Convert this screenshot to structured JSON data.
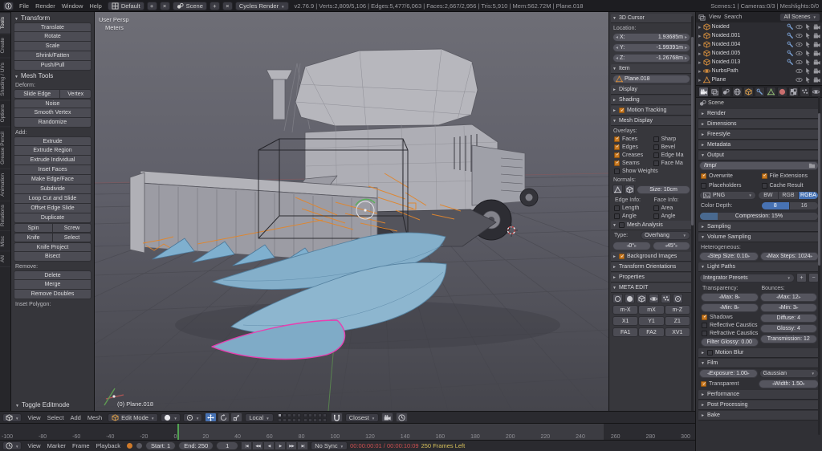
{
  "colors": {
    "accent_blue": "#4772b3",
    "check_orange": "#c97a23",
    "selected_magenta": "#e83eb0",
    "wire_orange": "#e0862e",
    "model_blue": "#84afca",
    "timecode_red": "#cf5050",
    "frames_left_yellow": "#d8c15a"
  },
  "icons": {
    "plus": "+",
    "close": "×",
    "minus": "−"
  },
  "info_bar": {
    "menus": [
      "File",
      "Render",
      "Window",
      "Help"
    ],
    "layout_name": "Default",
    "scene_name": "Scene",
    "engine": "Cycles Render",
    "stats": "v2.76.9 | Verts:2,809/5,106 | Edges:5,477/6,063 | Faces:2,667/2,956 | Tris:5,910 | Mem:562.72M | Plane.018",
    "scene_stats": "Scenes:1 | Cameras:0/3 | Meshlights:0/0"
  },
  "tab_strip": [
    "Tools",
    "Create",
    "Shading / UVs",
    "Options",
    "Grease Pencil",
    "Animation",
    "Relations",
    "Misc",
    "AN"
  ],
  "tool_shelf": {
    "transform_title": "Transform",
    "transform_buttons": [
      "Translate",
      "Rotate",
      "Scale",
      "Shrink/Fatten",
      "Push/Pull"
    ],
    "mesh_tools_title": "Mesh Tools",
    "deform_label": "Deform:",
    "slide_edge": "Slide Edge",
    "slide_vertex": "Vertex",
    "deform_buttons": [
      "Noise",
      "Smooth Vertex",
      "Randomize"
    ],
    "add_label": "Add:",
    "add_buttons": [
      "Extrude",
      "Extrude Region",
      "Extrude Individual",
      "Inset Faces",
      "Make Edge/Face",
      "Subdivide",
      "Loop Cut and Slide",
      "Offset Edge Slide",
      "Duplicate"
    ],
    "spin": "Spin",
    "screw": "Screw",
    "knife": "Knife",
    "knife_select": "Select",
    "add_buttons_2": [
      "Knife Project",
      "Bisect"
    ],
    "remove_label": "Remove:",
    "remove_buttons": [
      "Delete",
      "Merge",
      "Remove Doubles"
    ],
    "inset_label": "Inset Polygon:",
    "toggle_editmode": "Toggle Editmode"
  },
  "viewport": {
    "view_label": "User Persp",
    "unit_label": "Meters",
    "active_object": "(0) Plane.018"
  },
  "n_panel": {
    "cursor_title": "3D Cursor",
    "location_label": "Location:",
    "cursor_fields": [
      {
        "l": "X:",
        "v": "1.93685m"
      },
      {
        "l": "Y:",
        "v": "-1.99391m"
      },
      {
        "l": "Z:",
        "v": "-1.26768m"
      }
    ],
    "item_title": "Item",
    "item_name": "Plane.018",
    "display_title": "Display",
    "shading_title": "Shading",
    "motion_tracking_title": "Motion Tracking",
    "mesh_display_title": "Mesh Display",
    "overlays_label": "Overlays:",
    "overlay_left": [
      "Faces",
      "Edges",
      "Creases",
      "Seams"
    ],
    "overlay_right": [
      "Sharp",
      "Bevel",
      "Edge Ma",
      "Face Ma"
    ],
    "show_weights": "Show Weights",
    "normals_label": "Normals:",
    "normal_size": "Size: 10cm",
    "edge_info_label": "Edge Info:",
    "face_info_label": "Face Info:",
    "edge_info_checks": [
      "Length",
      "Angle"
    ],
    "face_info_checks": [
      "Area",
      "Angle"
    ],
    "mesh_analysis_title": "Mesh Analysis",
    "type_label": "Type:",
    "analysis_type": "Overhang",
    "analysis_min": "0°",
    "analysis_max": "45°",
    "background_images_title": "Background Images",
    "transform_orientations_title": "Transform Orientations",
    "properties_title": "Properties",
    "meta_edit_title": "META EDIT",
    "meta_row_1": [
      "m-X",
      "mX",
      "m-Z"
    ],
    "meta_row_2": [
      "X1",
      "Y1",
      "Z1"
    ],
    "meta_row_3": [
      "FA1",
      "FA2",
      "XV1"
    ]
  },
  "outliner": {
    "view_menu": "View",
    "search_menu": "Search",
    "display_mode": "All Scenes",
    "items": [
      {
        "name": "Noided"
      },
      {
        "name": "Noided.001"
      },
      {
        "name": "Noided.004"
      },
      {
        "name": "Noided.005"
      },
      {
        "name": "Noided.013"
      },
      {
        "name": "NurbsPath"
      },
      {
        "name": "Plane"
      }
    ]
  },
  "properties": {
    "context_label": "Scene",
    "render_title": "Render",
    "dimensions_title": "Dimensions",
    "freestyle_title": "Freestyle",
    "metadata_title": "Metadata",
    "output": {
      "title": "Output",
      "path": "/tmp/",
      "overwrite": "Overwrite",
      "file_extensions": "File Extensions",
      "placeholders": "Placeholders",
      "cache_result": "Cache Result",
      "format": "PNG",
      "color_modes": [
        "BW",
        "RGB",
        "RGBA"
      ],
      "color_depth_label": "Color Depth:",
      "color_depths": [
        "8",
        "16"
      ],
      "compression": "Compression: 15%"
    },
    "sampling_title": "Sampling",
    "volume_sampling": {
      "title": "Volume Sampling",
      "heterogeneous_label": "Heterogeneous:",
      "step_size": "Step Size: 0.10",
      "max_steps": "Max Steps: 1024"
    },
    "light_paths": {
      "title": "Light Paths",
      "presets": "Integrator Presets",
      "transparency_label": "Transparency:",
      "bounces_label": "Bounces:",
      "transparency_max": "Max: 8",
      "transparency_min": "Min: 8",
      "bounces_max": "Max: 12",
      "bounces_min": "Min: 3",
      "shadows": "Shadows",
      "diffuse": "Diffuse: 4",
      "glossy": "Glossy: 4",
      "transmission": "Transmission: 12",
      "reflective_caustics": "Reflective Caustics",
      "refractive_caustics": "Refractive Caustics",
      "filter_glossy": "Filter Glossy: 0.00"
    },
    "motion_blur_title": "Motion Blur",
    "film": {
      "title": "Film",
      "exposure": "Exposure: 1.00",
      "filter_type": "Gaussian",
      "transparent": "Transparent",
      "width": "Width: 1.50"
    },
    "performance_title": "Performance",
    "post_processing_title": "Post Processing",
    "bake_title": "Bake"
  },
  "view3d_header": {
    "menus": [
      "View",
      "Select",
      "Add",
      "Mesh"
    ],
    "mode": "Edit Mode",
    "orientation": "Local",
    "snap_target": "Closest"
  },
  "timeline": {
    "menus": [
      "View",
      "Marker",
      "Frame",
      "Playback"
    ],
    "start": "Start: 1",
    "end": "End: 250",
    "current_frame": "1",
    "playback_icons": [
      "|◀",
      "◀◀",
      "◀",
      "▶",
      "▶▶",
      "▶|"
    ],
    "sync": "No Sync",
    "timecode": "00:00:00:01 / 00:00:10:09",
    "frames_left": "250 Frames Left",
    "ruler_numbers": [
      "-100",
      "-80",
      "-60",
      "-40",
      "-20",
      "0",
      "20",
      "40",
      "60",
      "80",
      "100",
      "120",
      "140",
      "160",
      "180",
      "200",
      "220",
      "240",
      "260",
      "280",
      "300"
    ]
  }
}
